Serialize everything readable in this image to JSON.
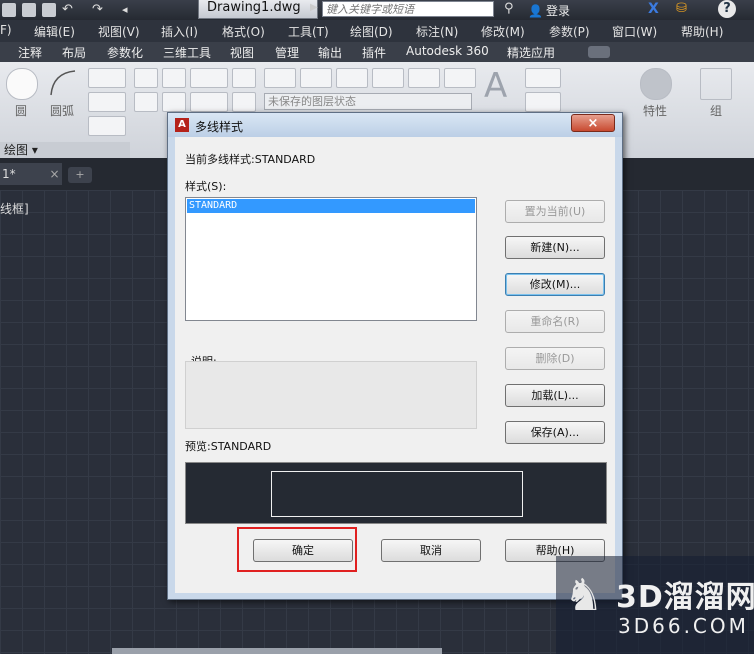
{
  "titlebar": {
    "file_name": "Drawing1.dwg",
    "search_placeholder": "键入关键字或短语",
    "login_label": "登录",
    "help_label": "?"
  },
  "menu": {
    "items": [
      "F)",
      "编辑(E)",
      "视图(V)",
      "插入(I)",
      "格式(O)",
      "工具(T)",
      "绘图(D)",
      "标注(N)",
      "修改(M)",
      "参数(P)",
      "窗口(W)",
      "帮助(H)"
    ]
  },
  "ribbon_tabs": {
    "items": [
      "注释",
      "布局",
      "参数化",
      "三维工具",
      "视图",
      "管理",
      "输出",
      "插件",
      "Autodesk 360",
      "精选应用"
    ]
  },
  "ribbon": {
    "circle_label": "圆",
    "arc_label": "圆弧",
    "layer_state": "未保存的图层状态",
    "text_label": "文字",
    "properties_label": "特性",
    "group_label": "组",
    "panel_draw": "绘图"
  },
  "document": {
    "tab_label": "1*",
    "view_label": "线框]"
  },
  "dialog": {
    "title": "多线样式",
    "current_style_label": "当前多线样式:STANDARD",
    "styles_label": "样式(S):",
    "styles": [
      "STANDARD"
    ],
    "description_label": "说明:",
    "preview_label": "预览:STANDARD",
    "buttons": {
      "set_current": "置为当前(U)",
      "new": "新建(N)...",
      "modify": "修改(M)...",
      "rename": "重命名(R)",
      "delete": "删除(D)",
      "load": "加载(L)...",
      "save": "保存(A)...",
      "ok": "确定",
      "cancel": "取消",
      "help": "帮助(H)"
    }
  },
  "watermark": {
    "line1": "3D溜溜网",
    "line2": "3D66.COM"
  }
}
